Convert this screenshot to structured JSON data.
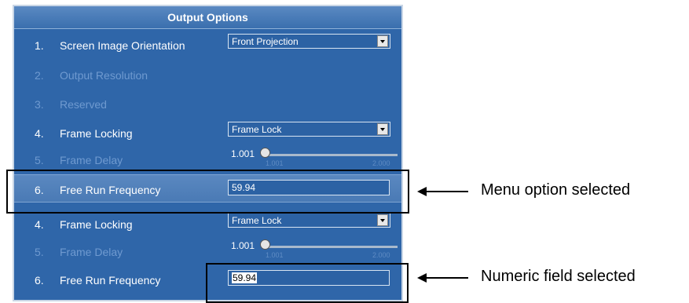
{
  "panel": {
    "title": "Output Options",
    "rows": [
      {
        "num": "1.",
        "label": "Screen Image Orientation",
        "control": "select",
        "value": "Front Projection",
        "disabled": false
      },
      {
        "num": "2.",
        "label": "Output Resolution",
        "control": "none",
        "disabled": true
      },
      {
        "num": "3.",
        "label": "Reserved",
        "control": "none",
        "disabled": true
      },
      {
        "num": "4.",
        "label": "Frame Locking",
        "control": "select",
        "value": "Frame Lock",
        "disabled": false
      },
      {
        "num": "5.",
        "label": "Frame Delay",
        "control": "slider",
        "value": "1.001",
        "min": "1.001",
        "max": "2.000",
        "disabled": true
      },
      {
        "num": "6.",
        "label": "Free Run Frequency",
        "control": "field",
        "value": "59.94",
        "disabled": false
      },
      {
        "num": "4.",
        "label": "Frame Locking",
        "control": "select",
        "value": "Frame Lock",
        "disabled": false
      },
      {
        "num": "5.",
        "label": "Frame Delay",
        "control": "slider",
        "value": "1.001",
        "min": "1.001",
        "max": "2.000",
        "disabled": true
      },
      {
        "num": "6.",
        "label": "Free Run Frequency",
        "control": "field",
        "value": "59.94",
        "disabled": false
      }
    ]
  },
  "callouts": {
    "menu_selected": "Menu option selected",
    "numeric_selected": "Numeric field selected"
  },
  "icons": {
    "dropdown": "chevron-down-icon",
    "arrow": "arrow-left-icon",
    "slider": "slider-knob-icon"
  }
}
